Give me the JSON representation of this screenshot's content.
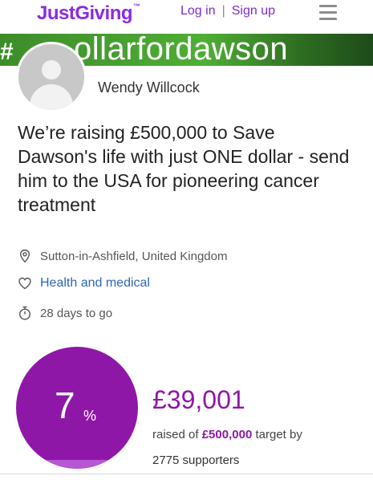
{
  "header": {
    "logo": "JustGiving",
    "logo_tm": "™",
    "login": "Log in",
    "separator": "|",
    "signup": "Sign up",
    "menu_icon": "hamburger-menu-icon"
  },
  "banner": {
    "hashtag_text": "ollarfordawson",
    "left_fragment": "#"
  },
  "page_owner": {
    "name": "Wendy Willcock",
    "avatar_icon": "default-user-avatar-icon"
  },
  "campaign": {
    "title": "We’re raising £500,000 to Save Dawson's life with just ONE dollar - send him to the USA for pioneering cancer treatment",
    "location": "Sutton-in-Ashfield, United Kingdom",
    "location_icon": "location-pin-icon",
    "category": "Health and medical",
    "category_icon": "heart-icon",
    "days_left": "28 days to go",
    "days_icon": "stopwatch-icon"
  },
  "progress": {
    "percent_value": 0.07,
    "percent_number": "7",
    "percent_symbol": "%",
    "raised_amount": "£39,001",
    "raised_prefix": "raised of",
    "target": "£500,000",
    "target_suffix": "target by",
    "supporters": "2775 supporters"
  },
  "colors": {
    "brand_purple": "#8a2be2",
    "progress_purple": "#8f17a8",
    "progress_fill": "#b757d4",
    "link_blue": "#2c67b6"
  }
}
